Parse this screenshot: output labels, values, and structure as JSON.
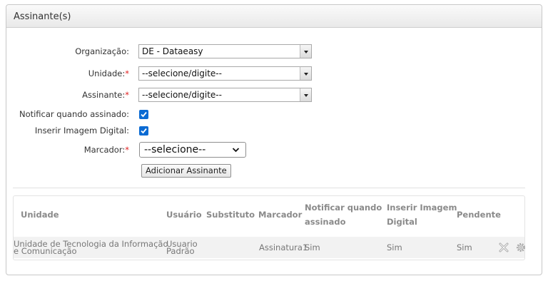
{
  "panel": {
    "title": "Assinante(s)"
  },
  "form": {
    "organizacao": {
      "label": "Organização:",
      "value": "DE - Dataeasy"
    },
    "unidade": {
      "label": "Unidade:",
      "required_mark": "*",
      "value": "--selecione/digite--"
    },
    "assinante": {
      "label": "Assinante:",
      "required_mark": "*",
      "value": "--selecione/digite--"
    },
    "notificar": {
      "label": "Notificar quando assinado:",
      "checked": true
    },
    "inserir_imagem": {
      "label": "Inserir Imagem Digital:",
      "checked": true
    },
    "marcador": {
      "label": "Marcador:",
      "required_mark": "*",
      "value": "--selecione--"
    },
    "add_button": "Adicionar Assinante"
  },
  "table": {
    "headers": {
      "unidade": "Unidade",
      "usuario": "Usuário",
      "substituto": "Substituto",
      "marcador": "Marcador",
      "notificar_1": "Notificar quando",
      "notificar_2": "assinado",
      "inserir_1": "Inserir Imagem",
      "inserir_2": "Digital",
      "pendente": "Pendente"
    },
    "rows": [
      {
        "unidade_1": "Unidade de Tecnologia da Informação",
        "unidade_2": "e Comunicação",
        "usuario_1": "Usuario",
        "usuario_2": "Padrão",
        "substituto": "",
        "marcador": "Assinatura1",
        "notificar": "Sim",
        "inserir": "Sim",
        "pendente": "Sim"
      }
    ]
  },
  "icons": {
    "remove": "close-x-icon",
    "settings": "gear-icon"
  },
  "colors": {
    "checkbox": "#0b6bd3",
    "required": "#e02020"
  }
}
